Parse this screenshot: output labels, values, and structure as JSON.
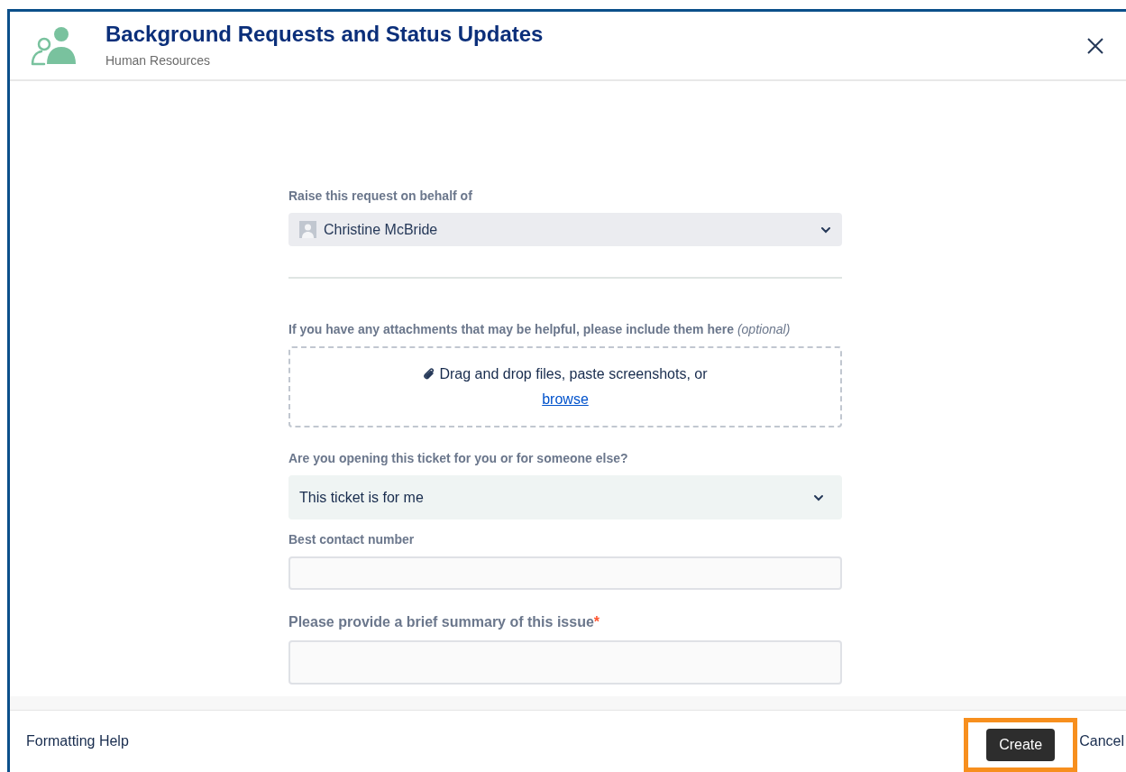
{
  "header": {
    "title": "Background Requests and Status Updates",
    "subtitle": "Human Resources"
  },
  "fields": [
    {
      "kind": "user-select",
      "label": "Raise this request on behalf of",
      "value": "Christine McBride"
    },
    {
      "kind": "divider"
    },
    {
      "kind": "attachment",
      "label": "If you have any attachments that may be helpful, please include them here",
      "optional": "(optional)",
      "prompt": "Drag and drop files, paste screenshots, or",
      "link": "browse"
    },
    {
      "kind": "select",
      "label": "Are you opening this ticket for you or for someone else?",
      "value": "This ticket is for me"
    },
    {
      "kind": "text",
      "label": "Best contact number"
    },
    {
      "kind": "text-large",
      "label": "Please provide a brief summary of this issue",
      "required": true,
      "required_mark": "*"
    }
  ],
  "footer": {
    "help": "Formatting Help",
    "create": {
      "label": "Create",
      "highlighted": true
    },
    "cancel": "Cancel"
  }
}
